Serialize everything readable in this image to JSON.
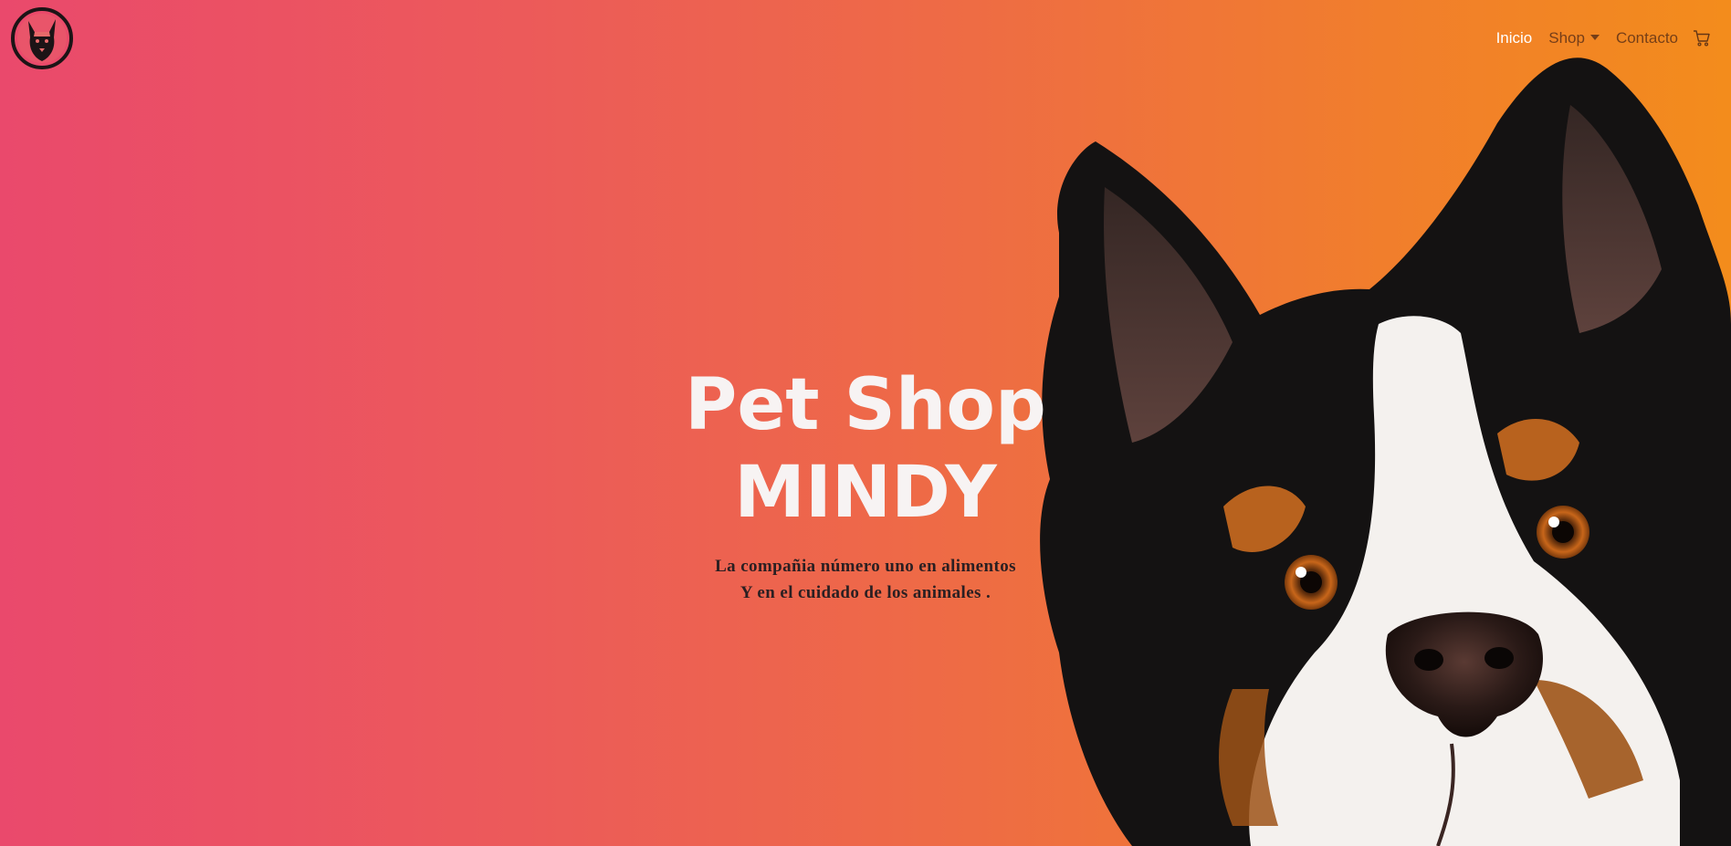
{
  "brand": {
    "logo_icon": "dog-head-logo-icon"
  },
  "nav": {
    "items": [
      {
        "label": "Inicio",
        "active": true
      },
      {
        "label": "Shop",
        "active": false,
        "has_dropdown": true
      },
      {
        "label": "Contacto",
        "active": false
      }
    ],
    "cart_icon": "shopping-cart-icon"
  },
  "hero": {
    "title_line1": "Pet Shop",
    "title_line2": "MINDY",
    "subtitle_line1": "La compañia número uno en alimentos",
    "subtitle_line2": "Y en el cuidado de los animales ."
  },
  "colors": {
    "gradient_start": "#ea496c",
    "gradient_end": "#f38c1c",
    "title": "#f7f3f3",
    "subtitle": "#2a1f22",
    "nav_active": "#ffffff"
  }
}
